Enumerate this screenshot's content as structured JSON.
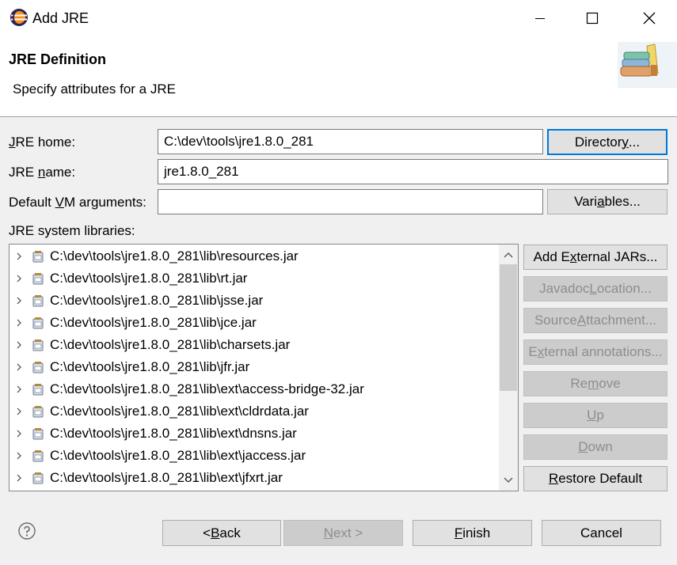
{
  "window": {
    "title": "Add JRE",
    "controls": [
      "minimize-icon",
      "maximize-icon",
      "close-icon"
    ]
  },
  "header": {
    "title": "JRE Definition",
    "subtitle": "Specify attributes for a JRE",
    "image": "books-icon"
  },
  "form": {
    "jre_home": {
      "label_pre": "",
      "label_mn": "J",
      "label_post": "RE home:",
      "value": "C:\\dev\\tools\\jre1.8.0_281"
    },
    "jre_name": {
      "label_pre": "JRE ",
      "label_mn": "n",
      "label_post": "ame:",
      "value": "jre1.8.0_281"
    },
    "vm_args": {
      "label_pre": "Default ",
      "label_mn": "V",
      "label_post": "M arguments:",
      "value": ""
    },
    "libraries_label": "JRE system libraries:"
  },
  "buttons": {
    "directory": {
      "pre": "Director",
      "mn": "y",
      "post": "..."
    },
    "variables": {
      "pre": "Vari",
      "mn": "a",
      "post": "bles..."
    },
    "add_external_jars": {
      "pre": "Add E",
      "mn": "x",
      "post": "ternal JARs..."
    },
    "javadoc_location": {
      "pre": "Javadoc ",
      "mn": "L",
      "post": "ocation..."
    },
    "source_attachment": {
      "pre": "Source ",
      "mn": "A",
      "post": "ttachment..."
    },
    "external_annotations": {
      "pre": "E",
      "mn": "x",
      "post": "ternal annotations..."
    },
    "remove": {
      "pre": "Re",
      "mn": "m",
      "post": "ove"
    },
    "up": {
      "pre": "",
      "mn": "U",
      "post": "p"
    },
    "down": {
      "pre": "",
      "mn": "D",
      "post": "own"
    },
    "restore_default": {
      "pre": "",
      "mn": "R",
      "post": "estore Default"
    }
  },
  "libraries": [
    "C:\\dev\\tools\\jre1.8.0_281\\lib\\resources.jar",
    "C:\\dev\\tools\\jre1.8.0_281\\lib\\rt.jar",
    "C:\\dev\\tools\\jre1.8.0_281\\lib\\jsse.jar",
    "C:\\dev\\tools\\jre1.8.0_281\\lib\\jce.jar",
    "C:\\dev\\tools\\jre1.8.0_281\\lib\\charsets.jar",
    "C:\\dev\\tools\\jre1.8.0_281\\lib\\jfr.jar",
    "C:\\dev\\tools\\jre1.8.0_281\\lib\\ext\\access-bridge-32.jar",
    "C:\\dev\\tools\\jre1.8.0_281\\lib\\ext\\cldrdata.jar",
    "C:\\dev\\tools\\jre1.8.0_281\\lib\\ext\\dnsns.jar",
    "C:\\dev\\tools\\jre1.8.0_281\\lib\\ext\\jaccess.jar",
    "C:\\dev\\tools\\jre1.8.0_281\\lib\\ext\\jfxrt.jar"
  ],
  "footer": {
    "back": {
      "pre": "< ",
      "mn": "B",
      "post": "ack"
    },
    "next": {
      "pre": "",
      "mn": "N",
      "post": "ext >"
    },
    "finish": {
      "pre": "",
      "mn": "F",
      "post": "inish"
    },
    "cancel": "Cancel",
    "help_icon": "help-icon"
  },
  "colors": {
    "focus_border": "#0078d7",
    "disabled_text": "#8d8d8d",
    "dialog_bg": "#f0f0f0"
  }
}
